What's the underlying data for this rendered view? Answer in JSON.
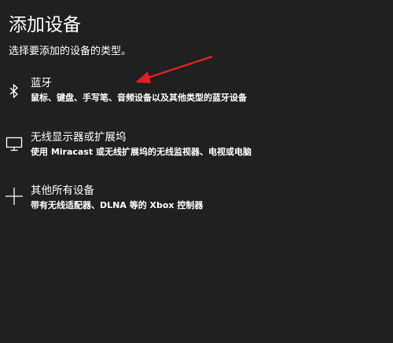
{
  "page": {
    "title": "添加设备",
    "subtitle": "选择要添加的设备的类型。"
  },
  "options": [
    {
      "icon": "bluetooth-icon",
      "label": "蓝牙",
      "description": "鼠标、键盘、手写笔、音频设备以及其他类型的蓝牙设备"
    },
    {
      "icon": "monitor-icon",
      "label": "无线显示器或扩展坞",
      "description": "使用 Miracast 或无线扩展坞的无线监视器、电视或电脑"
    },
    {
      "icon": "plus-icon",
      "label": "其他所有设备",
      "description": "带有无线适配器、DLNA 等的 Xbox 控制器"
    }
  ],
  "colors": {
    "background": "#202020",
    "text": "#ffffff",
    "annotation_arrow": "#e02020"
  }
}
